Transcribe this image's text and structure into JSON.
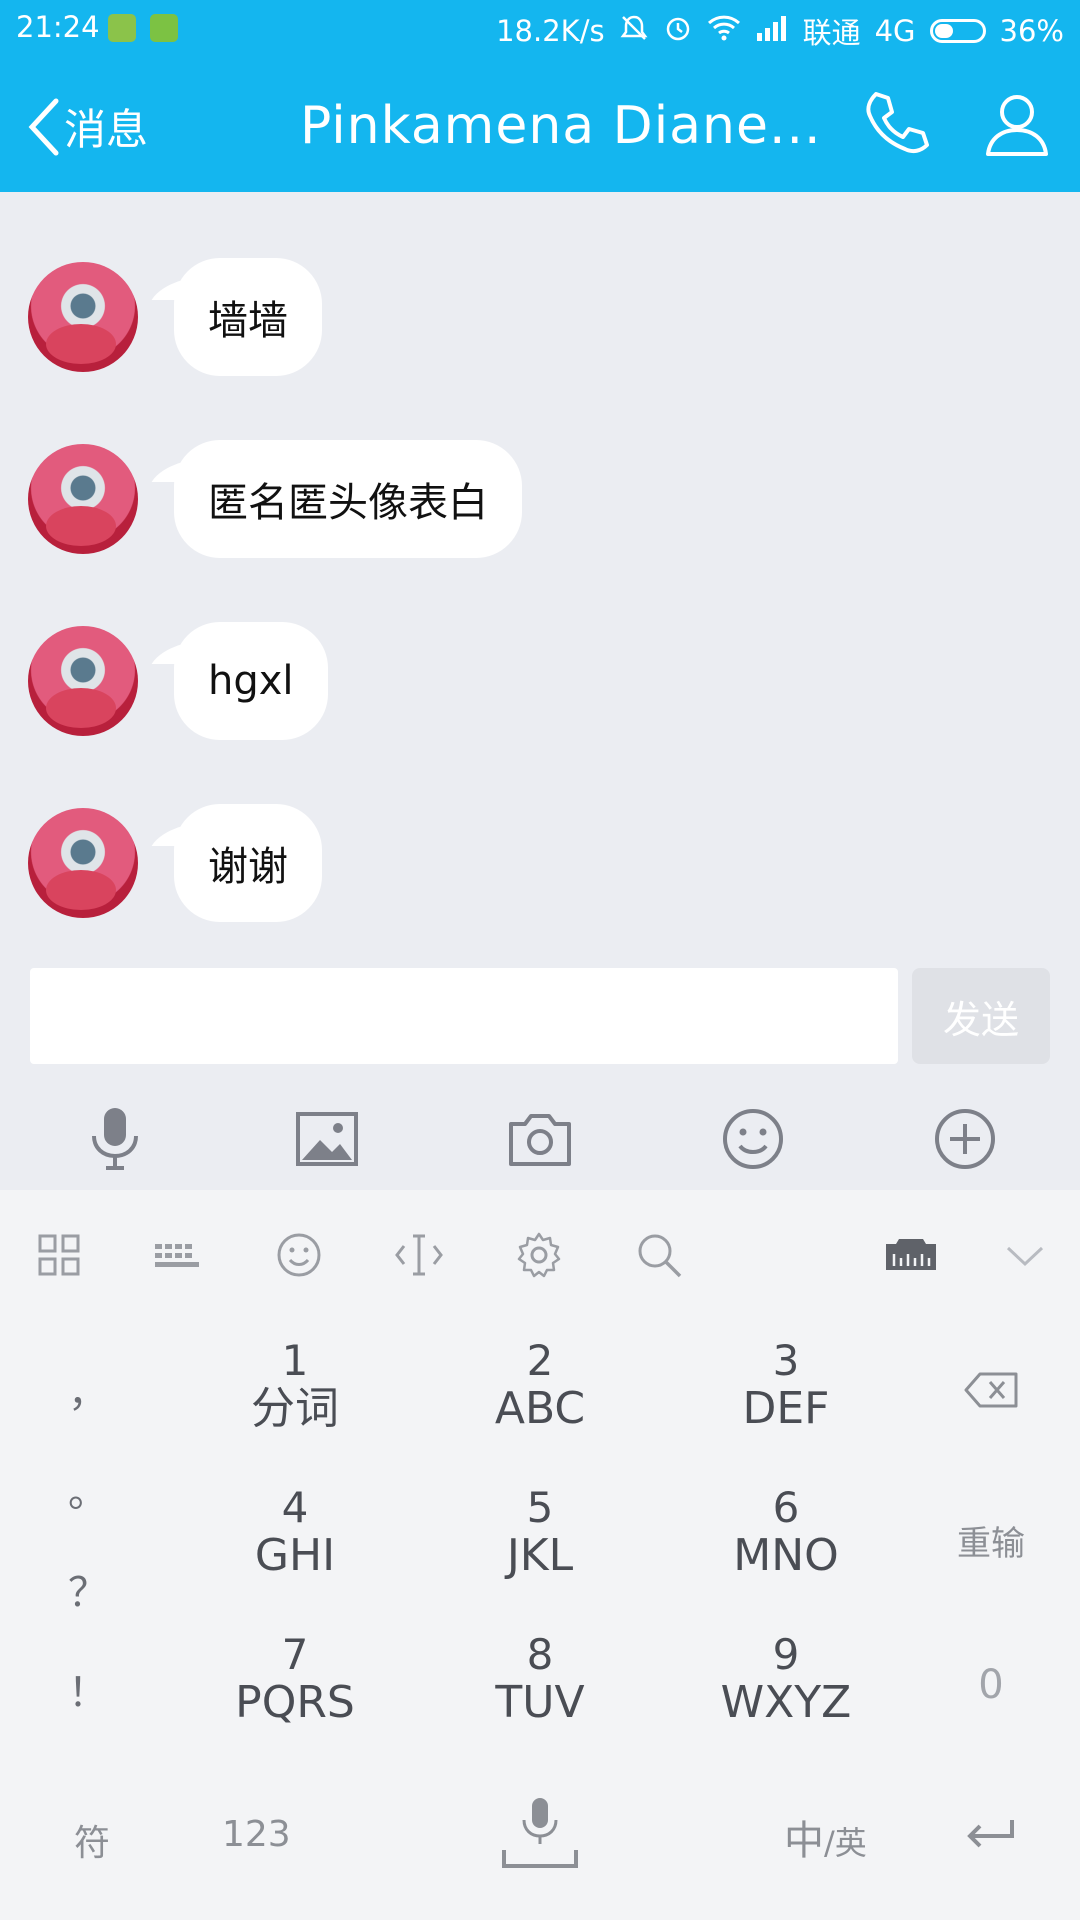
{
  "status_bar": {
    "time": "21:24",
    "speed": "18.2K/s",
    "carrier": "联通",
    "network": "4G",
    "battery": "36%",
    "battery_level": 0.36
  },
  "header": {
    "back_label": "消息",
    "title": "Pinkamena  Diane...",
    "call_icon": "phone-icon",
    "profile_icon": "user-icon",
    "color": "#14b6ef"
  },
  "messages": [
    {
      "text": "墙墙"
    },
    {
      "text": "匿名匿头像表白"
    },
    {
      "text": "hgxl"
    },
    {
      "text": "谢谢"
    }
  ],
  "composer": {
    "input_value": "",
    "send_label": "发送"
  },
  "tools": [
    "mic-icon",
    "image-icon",
    "camera-icon",
    "emoji-icon",
    "plus-icon"
  ],
  "keyboard": {
    "toolbar_icons": [
      "grid-icon",
      "keyboard-icon",
      "emoji-icon",
      "cursor-icon",
      "settings-icon",
      "search-icon",
      "ruler-icon",
      "collapse-icon"
    ],
    "left_column": [
      "，",
      "。",
      "？",
      "！"
    ],
    "keys": [
      {
        "num": "1",
        "letters": "分词"
      },
      {
        "num": "2",
        "letters": "ABC"
      },
      {
        "num": "3",
        "letters": "DEF"
      },
      {
        "num": "4",
        "letters": "GHI"
      },
      {
        "num": "5",
        "letters": "JKL"
      },
      {
        "num": "6",
        "letters": "MNO"
      },
      {
        "num": "7",
        "letters": "PQRS"
      },
      {
        "num": "8",
        "letters": "TUV"
      },
      {
        "num": "9",
        "letters": "WXYZ"
      }
    ],
    "right_column": {
      "backspace_icon": "backspace-icon",
      "reinput": "重输",
      "zero": "0"
    },
    "bottom": {
      "symbols": "符",
      "numbers": "123",
      "mic_icon": "mic-icon",
      "lang": "中",
      "lang_sep": "/英",
      "enter_icon": "enter-icon"
    }
  }
}
